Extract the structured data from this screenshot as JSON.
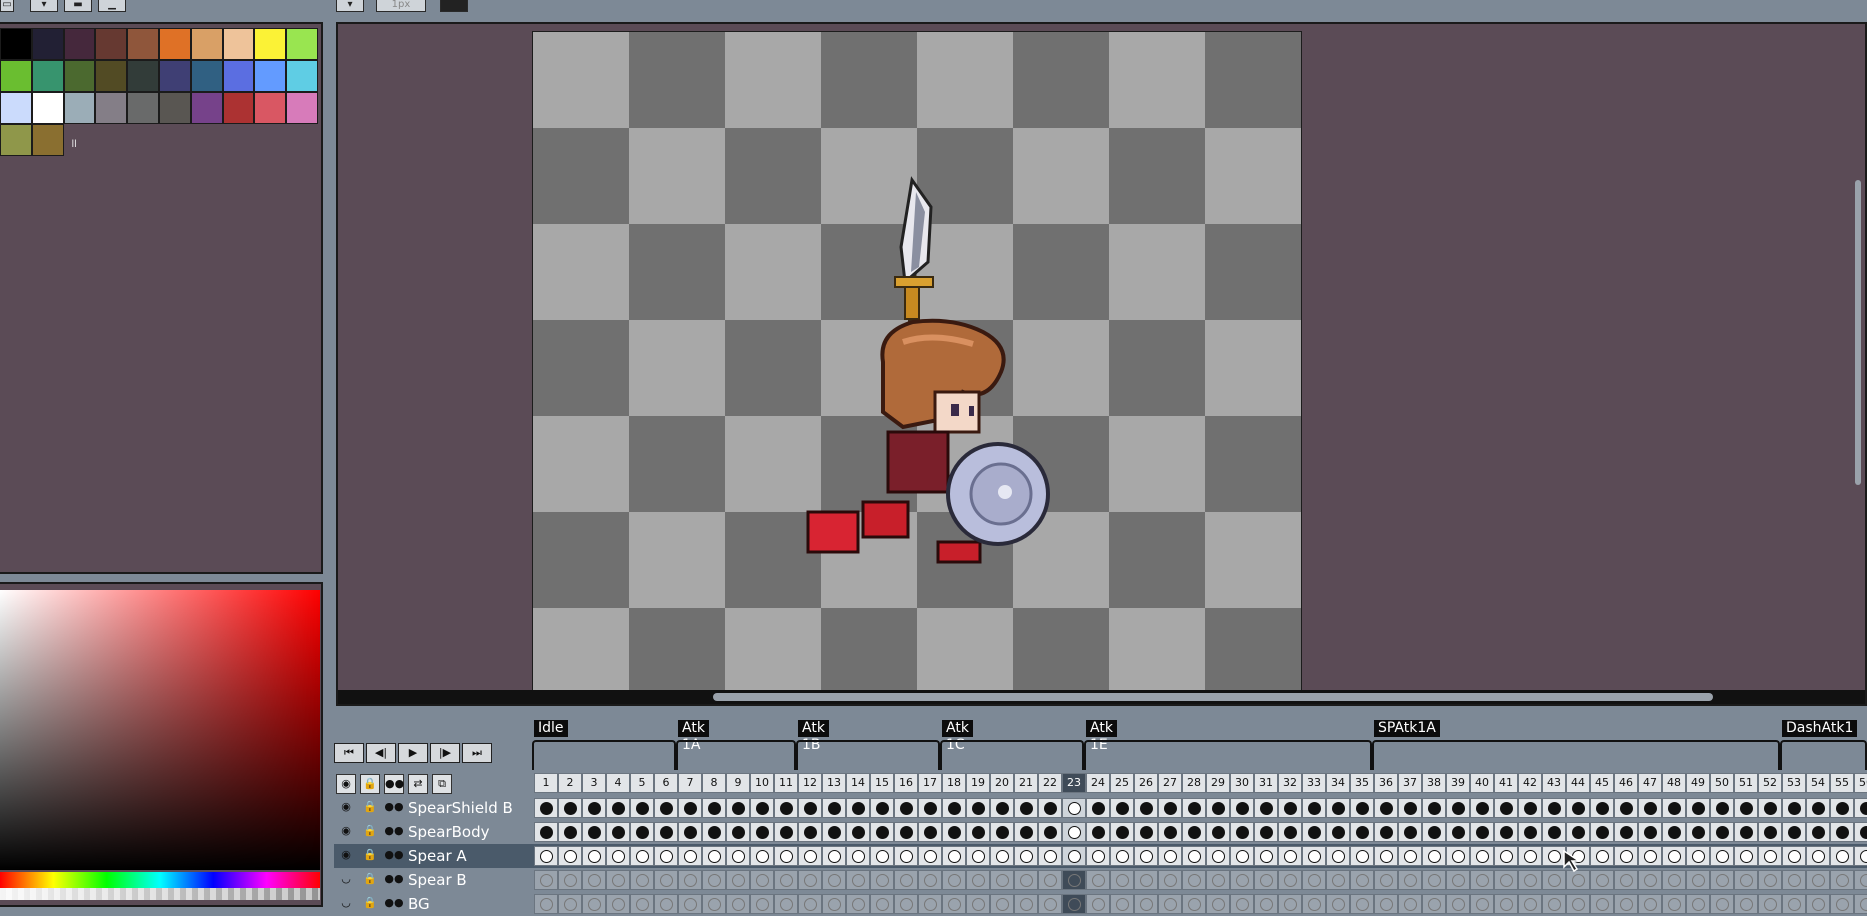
{
  "topbar": {
    "buttons": [
      "▭",
      "▾",
      "▬",
      "▁"
    ],
    "px_label": "1px"
  },
  "palette": {
    "rows": [
      [
        "#000000",
        "#222034",
        "#45283c",
        "#663931",
        "#8f563b",
        "#df7126",
        "#d9a066",
        "#eec39a",
        "#fbf236",
        "#99e550"
      ],
      [
        "#6abe30",
        "#37946e",
        "#4b692f",
        "#524b24",
        "#323c39",
        "#3f3f74",
        "#306082",
        "#5b6ee1",
        "#639bff",
        "#5fcde4"
      ],
      [
        "#cbdbfc",
        "#ffffff",
        "#9badb7",
        "#847e87",
        "#696a6a",
        "#595652",
        "#76428a",
        "#ac3232",
        "#d95763",
        "#d77bba"
      ],
      [
        "#8f974a",
        "#8a6f30"
      ]
    ],
    "selected_index": "2-1"
  },
  "timeline": {
    "tags": [
      {
        "label": "Idle",
        "start": 1,
        "end": 6
      },
      {
        "label": "Atk 1A",
        "start": 7,
        "end": 11
      },
      {
        "label": "Atk 1B",
        "start": 12,
        "end": 17
      },
      {
        "label": "Atk 1C",
        "start": 18,
        "end": 23
      },
      {
        "label": "Atk 1E",
        "start": 24,
        "end": 35
      },
      {
        "label": "SPAtk1A",
        "start": 36,
        "end": 52
      },
      {
        "label": "DashAtk1",
        "start": 53,
        "end": 56
      }
    ],
    "frame_count": 56,
    "current_frame": 23,
    "playback": [
      "⏮",
      "◀|",
      "▶",
      "|▶",
      "⏭"
    ],
    "header_icons": [
      "◉",
      "🔒",
      "●●",
      "⇄",
      "⧉"
    ],
    "layers": [
      {
        "name": "SpearShield B",
        "eye": "◉",
        "lock": "🔒",
        "link": "●●",
        "cels": "filled"
      },
      {
        "name": "SpearBody",
        "eye": "◉",
        "lock": "🔒",
        "link": "●●",
        "cels": "filled"
      },
      {
        "name": "Spear A",
        "eye": "◉",
        "lock": "🔒",
        "link": "●●",
        "cels": "open",
        "selected": true
      },
      {
        "name": "Spear B",
        "eye": "◡",
        "lock": "🔒",
        "link": "●●",
        "cels": "ghost"
      },
      {
        "name": "BG",
        "eye": "◡",
        "lock": "🔒",
        "link": "●●",
        "cels": "ghost"
      }
    ]
  },
  "colors": {
    "ui_bg": "#7d8996",
    "panel_bg": "#5b4b56",
    "selected_layer": "#4a5a6a"
  }
}
